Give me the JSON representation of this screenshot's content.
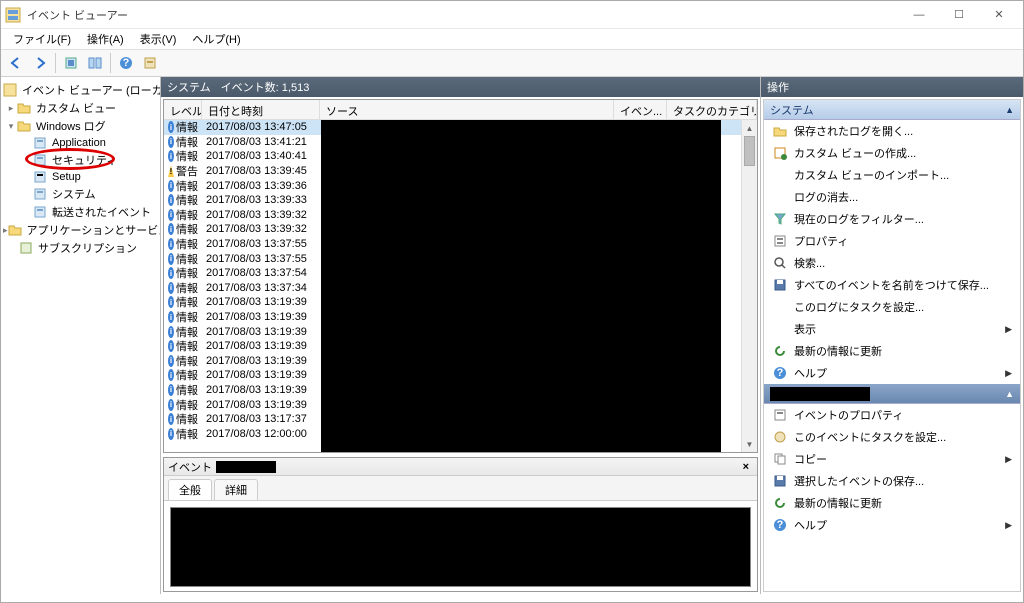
{
  "window": {
    "title": "イベント ビューアー"
  },
  "menu": {
    "file": "ファイル(F)",
    "action": "操作(A)",
    "view": "表示(V)",
    "help": "ヘルプ(H)"
  },
  "tree": {
    "root": "イベント ビューアー (ローカル)",
    "custom_view": "カスタム ビュー",
    "windows_log": "Windows ログ",
    "application": "Application",
    "security": "セキュリティ",
    "setup": "Setup",
    "system": "システム",
    "forwarded": "転送されたイベント",
    "app_service": "アプリケーションとサービス ログ",
    "subscription": "サブスクリプション"
  },
  "header": {
    "system": "システム",
    "count_label": "イベント数: 1,513"
  },
  "columns": {
    "level": "レベル",
    "datetime": "日付と時刻",
    "source": "ソース",
    "eventid": "イベン...",
    "category": "タスクのカテゴリ"
  },
  "events": {
    "info_label": "情報",
    "warn_label": "警告",
    "rows": [
      {
        "type": "info",
        "dt": "2017/08/03 13:47:05",
        "sel": true
      },
      {
        "type": "info",
        "dt": "2017/08/03 13:41:21"
      },
      {
        "type": "info",
        "dt": "2017/08/03 13:40:41"
      },
      {
        "type": "warn",
        "dt": "2017/08/03 13:39:45"
      },
      {
        "type": "info",
        "dt": "2017/08/03 13:39:36"
      },
      {
        "type": "info",
        "dt": "2017/08/03 13:39:33"
      },
      {
        "type": "info",
        "dt": "2017/08/03 13:39:32"
      },
      {
        "type": "info",
        "dt": "2017/08/03 13:39:32"
      },
      {
        "type": "info",
        "dt": "2017/08/03 13:37:55"
      },
      {
        "type": "info",
        "dt": "2017/08/03 13:37:55"
      },
      {
        "type": "info",
        "dt": "2017/08/03 13:37:54"
      },
      {
        "type": "info",
        "dt": "2017/08/03 13:37:34"
      },
      {
        "type": "info",
        "dt": "2017/08/03 13:19:39"
      },
      {
        "type": "info",
        "dt": "2017/08/03 13:19:39"
      },
      {
        "type": "info",
        "dt": "2017/08/03 13:19:39"
      },
      {
        "type": "info",
        "dt": "2017/08/03 13:19:39"
      },
      {
        "type": "info",
        "dt": "2017/08/03 13:19:39"
      },
      {
        "type": "info",
        "dt": "2017/08/03 13:19:39"
      },
      {
        "type": "info",
        "dt": "2017/08/03 13:19:39"
      },
      {
        "type": "info",
        "dt": "2017/08/03 13:19:39"
      },
      {
        "type": "info",
        "dt": "2017/08/03 13:17:37"
      },
      {
        "type": "info",
        "dt": "2017/08/03 12:00:00"
      }
    ]
  },
  "detail": {
    "header_label": "イベント",
    "tab_general": "全般",
    "tab_detail": "詳細"
  },
  "actions": {
    "title": "操作",
    "section_system": "システム",
    "open_saved_log": "保存されたログを開く...",
    "create_custom_view": "カスタム ビューの作成...",
    "import_custom_view": "カスタム ビューのインポート...",
    "clear_log": "ログの消去...",
    "filter_log": "現在のログをフィルター...",
    "properties": "プロパティ",
    "find": "検索...",
    "save_all": "すべてのイベントを名前をつけて保存...",
    "attach_task": "このログにタスクを設定...",
    "view": "表示",
    "refresh": "最新の情報に更新",
    "help": "ヘルプ",
    "event_props": "イベントのプロパティ",
    "attach_task_event": "このイベントにタスクを設定...",
    "copy": "コピー",
    "save_selected": "選択したイベントの保存...",
    "refresh2": "最新の情報に更新",
    "help2": "ヘルプ"
  }
}
